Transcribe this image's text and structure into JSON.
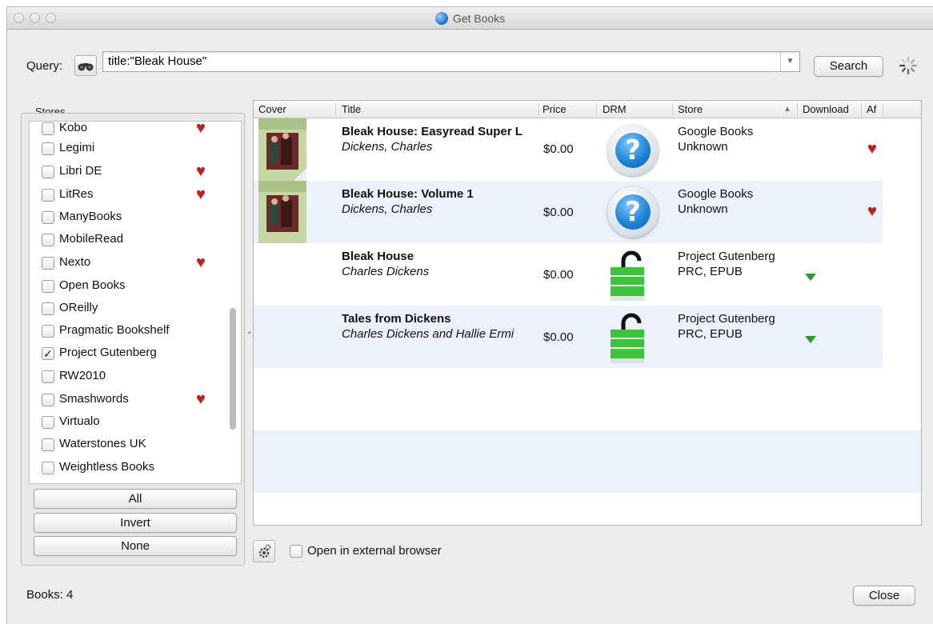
{
  "window": {
    "title": "Get Books"
  },
  "query": {
    "label": "Query:",
    "value": "title:\"Bleak House\"",
    "search_label": "Search"
  },
  "stores": {
    "title": "Stores",
    "items": [
      {
        "name": "Kobo",
        "checked": false,
        "affiliate": true
      },
      {
        "name": "Legimi",
        "checked": false,
        "affiliate": false
      },
      {
        "name": "Libri DE",
        "checked": false,
        "affiliate": true
      },
      {
        "name": "LitRes",
        "checked": false,
        "affiliate": true
      },
      {
        "name": "ManyBooks",
        "checked": false,
        "affiliate": false
      },
      {
        "name": "MobileRead",
        "checked": false,
        "affiliate": false
      },
      {
        "name": "Nexto",
        "checked": false,
        "affiliate": true
      },
      {
        "name": "Open Books",
        "checked": false,
        "affiliate": false
      },
      {
        "name": "OReilly",
        "checked": false,
        "affiliate": false
      },
      {
        "name": "Pragmatic Bookshelf",
        "checked": false,
        "affiliate": false
      },
      {
        "name": "Project Gutenberg",
        "checked": true,
        "affiliate": false
      },
      {
        "name": "RW2010",
        "checked": false,
        "affiliate": false
      },
      {
        "name": "Smashwords",
        "checked": false,
        "affiliate": true
      },
      {
        "name": "Virtualo",
        "checked": false,
        "affiliate": false
      },
      {
        "name": "Waterstones UK",
        "checked": false,
        "affiliate": false
      },
      {
        "name": "Weightless Books",
        "checked": false,
        "affiliate": false
      }
    ],
    "all_label": "All",
    "invert_label": "Invert",
    "none_label": "None"
  },
  "table": {
    "columns": [
      "Cover",
      "Title",
      "Price",
      "DRM",
      "Store",
      "Download",
      "Af"
    ],
    "rows": [
      {
        "title": "Bleak House: Easyread Super L",
        "author": "Dickens, Charles",
        "price": "$0.00",
        "drm": "unknown",
        "store": "Google Books",
        "formats": "Unknown",
        "download": false,
        "affiliate": true,
        "cover": true
      },
      {
        "title": "Bleak House: Volume 1",
        "author": "Dickens, Charles",
        "price": "$0.00",
        "drm": "unknown",
        "store": "Google Books",
        "formats": "Unknown",
        "download": false,
        "affiliate": true,
        "cover": true
      },
      {
        "title": "Bleak House",
        "author": "Charles Dickens",
        "price": "$0.00",
        "drm": "unlocked",
        "store": "Project Gutenberg",
        "formats": "PRC, EPUB",
        "download": true,
        "affiliate": false,
        "cover": false
      },
      {
        "title": "Tales from Dickens",
        "author": "Charles Dickens and Hallie Ermi",
        "price": "$0.00",
        "drm": "unlocked",
        "store": "Project Gutenberg",
        "formats": "PRC, EPUB",
        "download": true,
        "affiliate": false,
        "cover": false
      }
    ]
  },
  "footer": {
    "external_browser_label": "Open in external browser",
    "books_label": "Books:",
    "books_count": "4",
    "close_label": "Close"
  }
}
